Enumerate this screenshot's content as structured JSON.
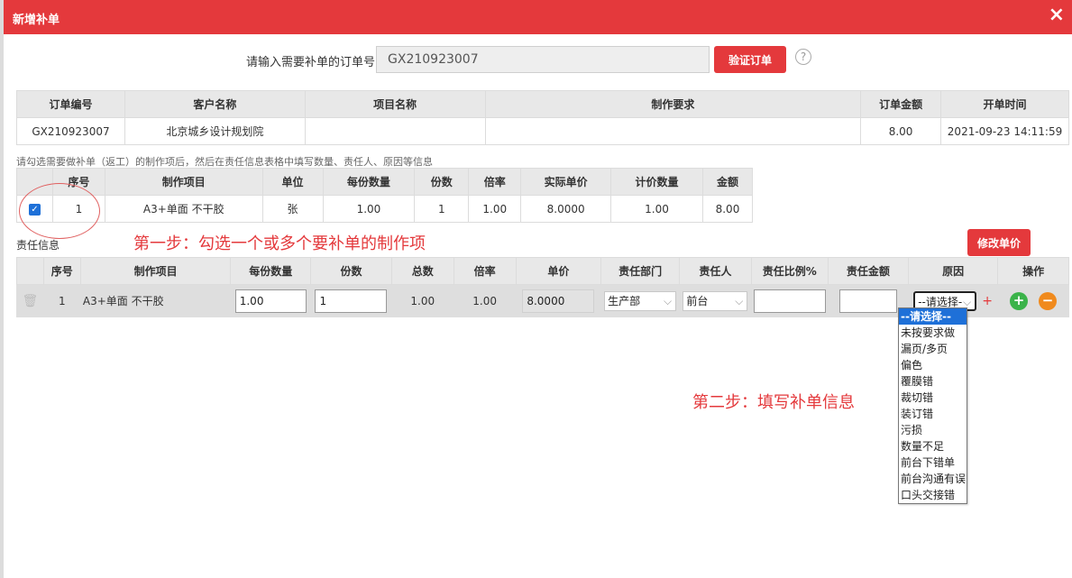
{
  "dialog": {
    "title": "新增补单",
    "close_icon": "×"
  },
  "order_lookup": {
    "label": "请输入需要补单的订单号:",
    "value": "GX210923007",
    "verify_button": "验证订单",
    "help_icon": "?"
  },
  "order_table": {
    "headers": [
      "订单编号",
      "客户名称",
      "项目名称",
      "制作要求",
      "订单金额",
      "开单时间"
    ],
    "row": [
      "GX210923007",
      "北京城乡设计规划院",
      "",
      "",
      "8.00",
      "2021-09-23 14:11:59"
    ]
  },
  "items_hint": "请勾选需要做补单（返工）的制作项后，然后在责任信息表格中填写数量、责任人、原因等信息",
  "items_table": {
    "headers": [
      "",
      "序号",
      "制作项目",
      "单位",
      "每份数量",
      "份数",
      "倍率",
      "实际单价",
      "计价数量",
      "金额"
    ],
    "row": {
      "checked": true,
      "checkbox_icon": "✓",
      "cells": [
        "1",
        "A3+单面 不干胶",
        "张",
        "1.00",
        "1",
        "1.00",
        "8.0000",
        "1.00",
        "8.00"
      ]
    }
  },
  "annotations": {
    "step1": "第一步：勾选一个或多个要补单的制作项",
    "step2": "第二步：填写补单信息"
  },
  "responsibility": {
    "section_label": "责任信息",
    "modify_price_button": "修改单价",
    "headers": [
      "",
      "序号",
      "制作项目",
      "每份数量",
      "份数",
      "总数",
      "倍率",
      "单价",
      "责任部门",
      "责任人",
      "责任比例%",
      "责任金额",
      "原因",
      "操作"
    ],
    "row": {
      "trash_icon": "🗑",
      "index": "1",
      "item": "A3+单面 不干胶",
      "qty_per_copy": "1.00",
      "copies": "1",
      "total": "1.00",
      "rate": "1.00",
      "unit_price": "8.0000",
      "department": "生产部",
      "person": "前台",
      "ratio": "",
      "amount": "",
      "reason_selected": "--请选择-",
      "add_reason_icon": "+",
      "add_icon": "+",
      "remove_icon": "−"
    },
    "reason_options": [
      "--请选择--",
      "未按要求做",
      "漏页/多页",
      "偏色",
      "覆膜错",
      "裁切错",
      "装订错",
      "污损",
      "数量不足",
      "前台下错单",
      "前台沟通有误",
      "口头交接错"
    ],
    "reason_selected_index": 0
  },
  "colors": {
    "brand_red": "#e4393c",
    "add_green": "#3bb34a",
    "remove_orange": "#f08a1d",
    "select_blue": "#1e70d8"
  }
}
